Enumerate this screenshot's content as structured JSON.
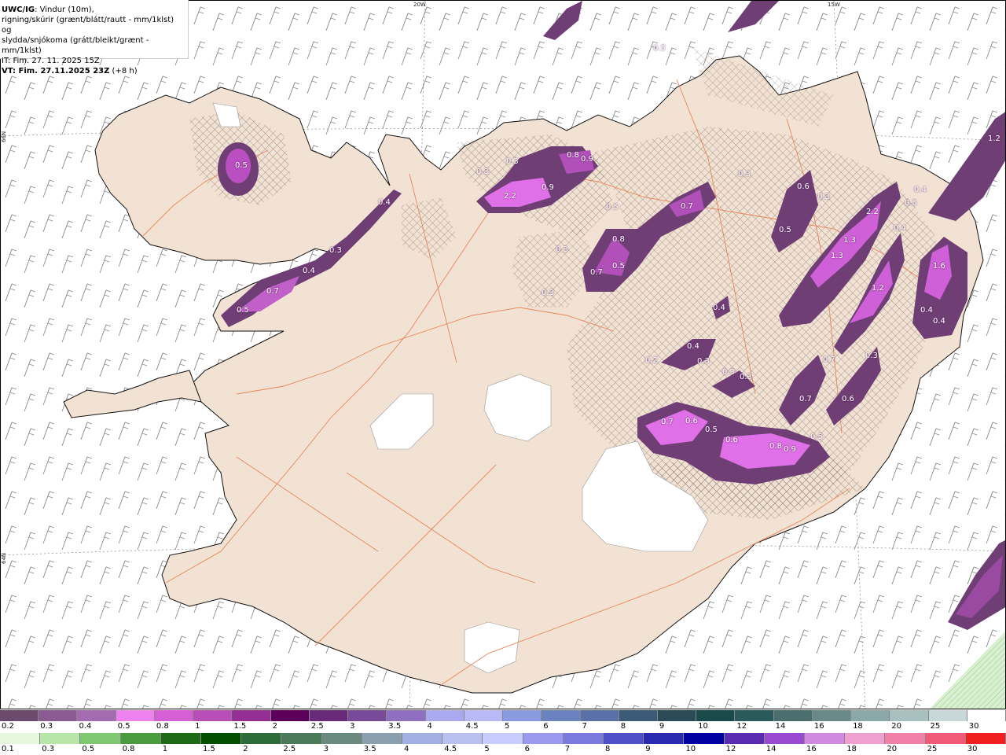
{
  "header": {
    "model": "UWC/IG",
    "line1_rest": ": Vindur (10m),",
    "line2": "rigning/skúrir (grænt/blátt/rautt - mm/1klst) og",
    "line3": "slydda/snjókoma (grátt/bleikt/grænt - mm/1klst)",
    "line4": "IT: Fim. 27. 11. 2025 15Z",
    "line5_bold": "VT: Fim. 27.11.2025 23Z",
    "line5_rest": " (+8 h)"
  },
  "graticule": {
    "lon_labels": [
      "20W",
      "15W"
    ],
    "lat_labels": [
      "66N",
      "64N"
    ]
  },
  "precip_values": [
    "0.5",
    "0.4",
    "0.3",
    "0.4",
    "0.7",
    "0.5",
    "0.3",
    "0.3",
    "2.2",
    "0.9",
    "0.8",
    "0.9",
    "0.5",
    "0.3",
    "0.7",
    "0.8",
    "0.5",
    "0.7",
    "0.3",
    "0.3",
    "0.6",
    "0.3",
    "2.2",
    "0.5",
    "0.4",
    "0.5",
    "1.3",
    "1.3",
    "1.2",
    "1.2",
    "0.4",
    "1.6",
    "0.4",
    "0.4",
    "0.4",
    "0.4",
    "0.3",
    "0.3",
    "0.3",
    "0.7",
    "0.7",
    "0.6",
    "0.7",
    "0.6",
    "0.5",
    "0.6",
    "0.8",
    "0.9",
    "0.5",
    "0.3",
    "0.2",
    "0.5"
  ],
  "legend_snow": {
    "labels": [
      "0.2",
      "0.3",
      "0.4",
      "0.5",
      "0.8",
      "1",
      "1.5",
      "2",
      "2.5",
      "3",
      "3.5",
      "4",
      "4.5",
      "5",
      "6",
      "7",
      "8",
      "9",
      "10",
      "12",
      "14",
      "16",
      "18",
      "20",
      "25",
      "30"
    ],
    "colors": [
      "#6b4a6e",
      "#8a5a92",
      "#a36cb0",
      "#ee82ee",
      "#d65fd6",
      "#b84fb8",
      "#952f95",
      "#5c005c",
      "#6a2a7a",
      "#7a4a9a",
      "#8f6fbf",
      "#a9a9ef",
      "#b9b9f7",
      "#8a9ae0",
      "#6a82c0",
      "#5a70a8",
      "#3a5a78",
      "#2a4a58",
      "#1a4a4a",
      "#2a5a5a",
      "#4a6e6e",
      "#6a8a8a",
      "#8aa8a8",
      "#a8c0c0",
      "#c8d8d8",
      "#ffffff"
    ]
  },
  "legend_rain": {
    "labels": [
      "0.1",
      "0.3",
      "0.5",
      "0.8",
      "1",
      "1.5",
      "2",
      "2.5",
      "3",
      "3.5",
      "4",
      "4.5",
      "5",
      "6",
      "7",
      "8",
      "9",
      "10",
      "12",
      "14",
      "16",
      "18",
      "20",
      "25",
      "30"
    ],
    "colors": [
      "#e6f7e0",
      "#b8e6a8",
      "#7fc770",
      "#4a9a3e",
      "#1f6a14",
      "#005000",
      "#2e6b3a",
      "#4a7a5a",
      "#6a8a80",
      "#8aa0b0",
      "#a0b0e0",
      "#b8c0f0",
      "#c8ccff",
      "#9a9af0",
      "#7a7ae0",
      "#5050c8",
      "#2a2ab0",
      "#0000a0",
      "#5a2ab0",
      "#9a4ad0",
      "#d08ae0",
      "#f0a0d0",
      "#f080a8",
      "#f05a78",
      "#f02020"
    ]
  }
}
